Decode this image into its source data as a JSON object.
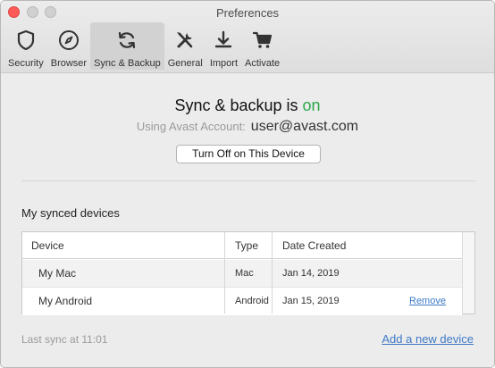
{
  "window": {
    "title": "Preferences"
  },
  "toolbar": {
    "items": [
      {
        "label": "Security",
        "icon": "shield-icon",
        "selected": false
      },
      {
        "label": "Browser",
        "icon": "compass-icon",
        "selected": false
      },
      {
        "label": "Sync & Backup",
        "icon": "sync-icon",
        "selected": true
      },
      {
        "label": "General",
        "icon": "tools-icon",
        "selected": false
      },
      {
        "label": "Import",
        "icon": "download-icon",
        "selected": false
      },
      {
        "label": "Activate",
        "icon": "cart-icon",
        "selected": false
      }
    ]
  },
  "sync": {
    "status_prefix": "Sync & backup is ",
    "status_value": "on",
    "status_color": "#2ba84a",
    "account_label": "Using Avast Account:",
    "account_email": "user@avast.com",
    "turn_off_label": "Turn Off on This Device"
  },
  "devices": {
    "title": "My synced devices",
    "columns": [
      "Device",
      "Type",
      "Date Created"
    ],
    "rows": [
      {
        "device": "My Mac",
        "type": "Mac",
        "date": "Jan 14, 2019",
        "action": ""
      },
      {
        "device": "My Android",
        "type": "Android",
        "date": "Jan 15, 2019",
        "action": "Remove"
      }
    ]
  },
  "footer": {
    "last_sync": "Last sync at 11:01",
    "add_device": "Add a new device"
  },
  "colors": {
    "link": "#3e79c7",
    "close_button": "#fc5b57"
  }
}
